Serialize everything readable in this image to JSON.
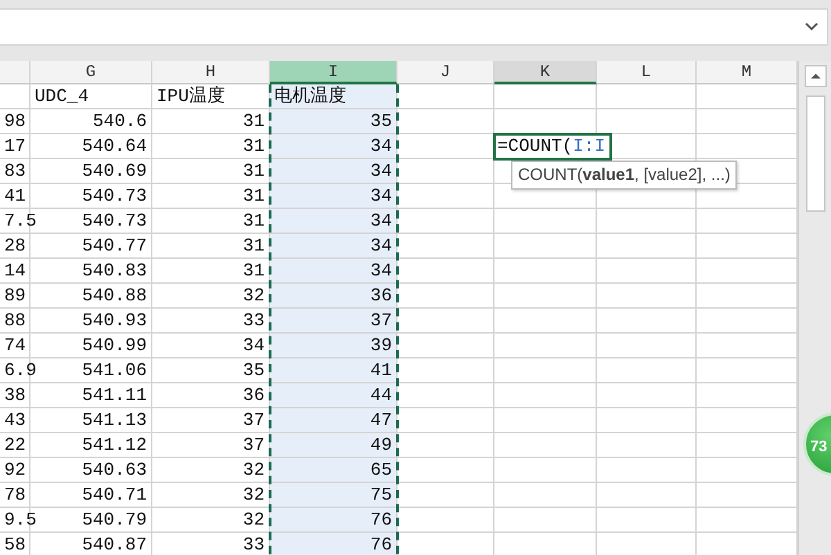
{
  "formula_bar": {
    "dropdown": true
  },
  "columns": [
    {
      "selected": false,
      "current": false
    },
    {
      "label": "G",
      "selected": false,
      "current": false
    },
    {
      "label": "H",
      "selected": false,
      "current": false
    },
    {
      "label": "I",
      "selected": true,
      "current": false
    },
    {
      "label": "J",
      "selected": false,
      "current": false
    },
    {
      "label": "K",
      "selected": false,
      "current": true
    },
    {
      "label": "L",
      "selected": false,
      "current": false
    },
    {
      "label": "M",
      "selected": false,
      "current": false
    }
  ],
  "label_row": [
    "UDC_4",
    "IPU温度",
    "电机温度"
  ],
  "rows": [
    {
      "cells": [
        "98",
        "540.6",
        "31",
        "35"
      ]
    },
    {
      "cells": [
        "17",
        "540.64",
        "31",
        "34"
      ],
      "editor": {
        "text": "=COUNT(",
        "reference": "I:I",
        "hint": "COUNT(**value1**, [value2], ...)"
      }
    },
    {
      "cells": [
        "83",
        "540.69",
        "31",
        "34"
      ]
    },
    {
      "cells": [
        "41",
        "540.73",
        "31",
        "34"
      ]
    },
    {
      "cells": [
        "7.5",
        "540.73",
        "31",
        "34"
      ]
    },
    {
      "cells": [
        "28",
        "540.77",
        "31",
        "34"
      ]
    },
    {
      "cells": [
        "14",
        "540.83",
        "31",
        "34"
      ]
    },
    {
      "cells": [
        "89",
        "540.88",
        "32",
        "36"
      ]
    },
    {
      "cells": [
        "88",
        "540.93",
        "33",
        "37"
      ]
    },
    {
      "cells": [
        "74",
        "540.99",
        "34",
        "39"
      ]
    },
    {
      "cells": [
        "6.9",
        "541.06",
        "35",
        "41"
      ]
    },
    {
      "cells": [
        "38",
        "541.11",
        "36",
        "44"
      ]
    },
    {
      "cells": [
        "43",
        "541.13",
        "37",
        "47"
      ]
    },
    {
      "cells": [
        "22",
        "541.12",
        "37",
        "49"
      ]
    },
    {
      "cells": [
        "92",
        "540.63",
        "32",
        "65"
      ]
    },
    {
      "cells": [
        "78",
        "540.71",
        "32",
        "75"
      ]
    },
    {
      "cells": [
        "9.5",
        "540.79",
        "32",
        "76"
      ]
    },
    {
      "cells": [
        "58",
        "540.87",
        "33",
        "76"
      ]
    }
  ],
  "floating_badge": {
    "text": "73"
  }
}
